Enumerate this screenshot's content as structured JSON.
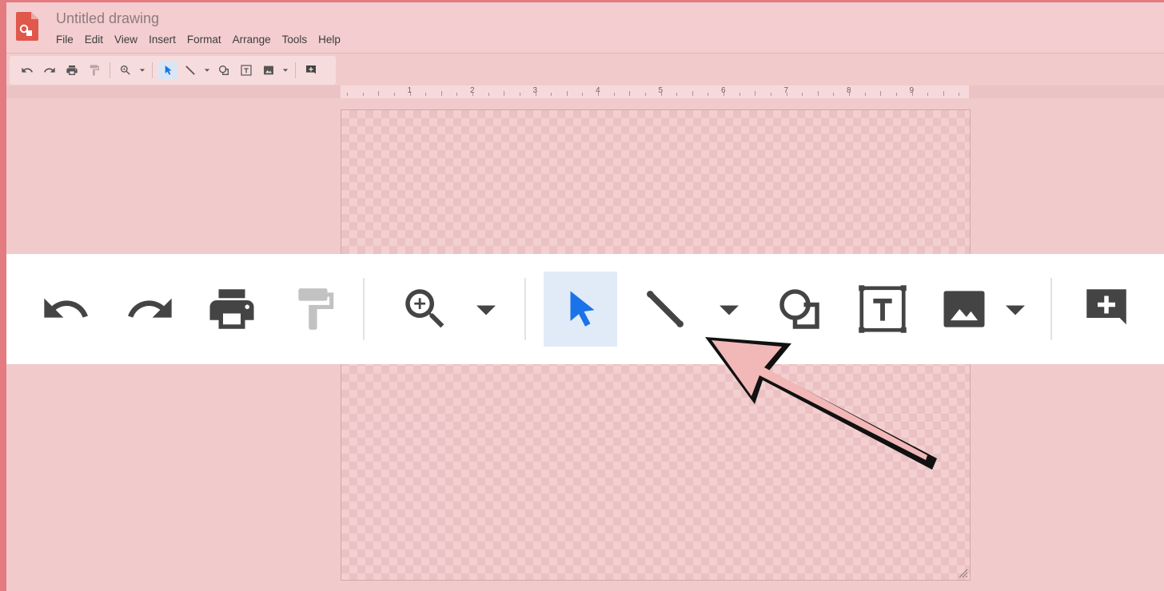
{
  "document": {
    "title": "Untitled drawing"
  },
  "menubar": {
    "items": [
      "File",
      "Edit",
      "View",
      "Insert",
      "Format",
      "Arrange",
      "Tools",
      "Help"
    ]
  },
  "ruler": {
    "numbers": [
      "1",
      "2",
      "3",
      "4",
      "5",
      "6",
      "7",
      "8",
      "9"
    ]
  },
  "toolbar": {
    "buttons": [
      {
        "name": "undo",
        "icon": "undo-icon"
      },
      {
        "name": "redo",
        "icon": "redo-icon"
      },
      {
        "name": "print",
        "icon": "print-icon"
      },
      {
        "name": "paint-format",
        "icon": "paint-roller-icon",
        "disabled": true
      },
      {
        "name": "zoom",
        "icon": "zoom-in-icon",
        "has_dropdown": true
      },
      {
        "name": "select",
        "icon": "cursor-arrow-icon",
        "active": true
      },
      {
        "name": "line",
        "icon": "line-icon",
        "has_dropdown": true
      },
      {
        "name": "shape",
        "icon": "shape-icon"
      },
      {
        "name": "text-box",
        "icon": "text-box-icon"
      },
      {
        "name": "image",
        "icon": "image-icon",
        "has_dropdown": true
      },
      {
        "name": "comment",
        "icon": "add-comment-icon"
      }
    ]
  },
  "colors": {
    "overlay_tint": "#f1cacc",
    "active_tool_bg": "#e1ebf8",
    "active_tool_icon": "#1a73e8",
    "icon_dark": "#444444",
    "icon_disabled": "#bdbdbd",
    "logo_red": "#db4437",
    "annotation_arrow": "#111111"
  }
}
